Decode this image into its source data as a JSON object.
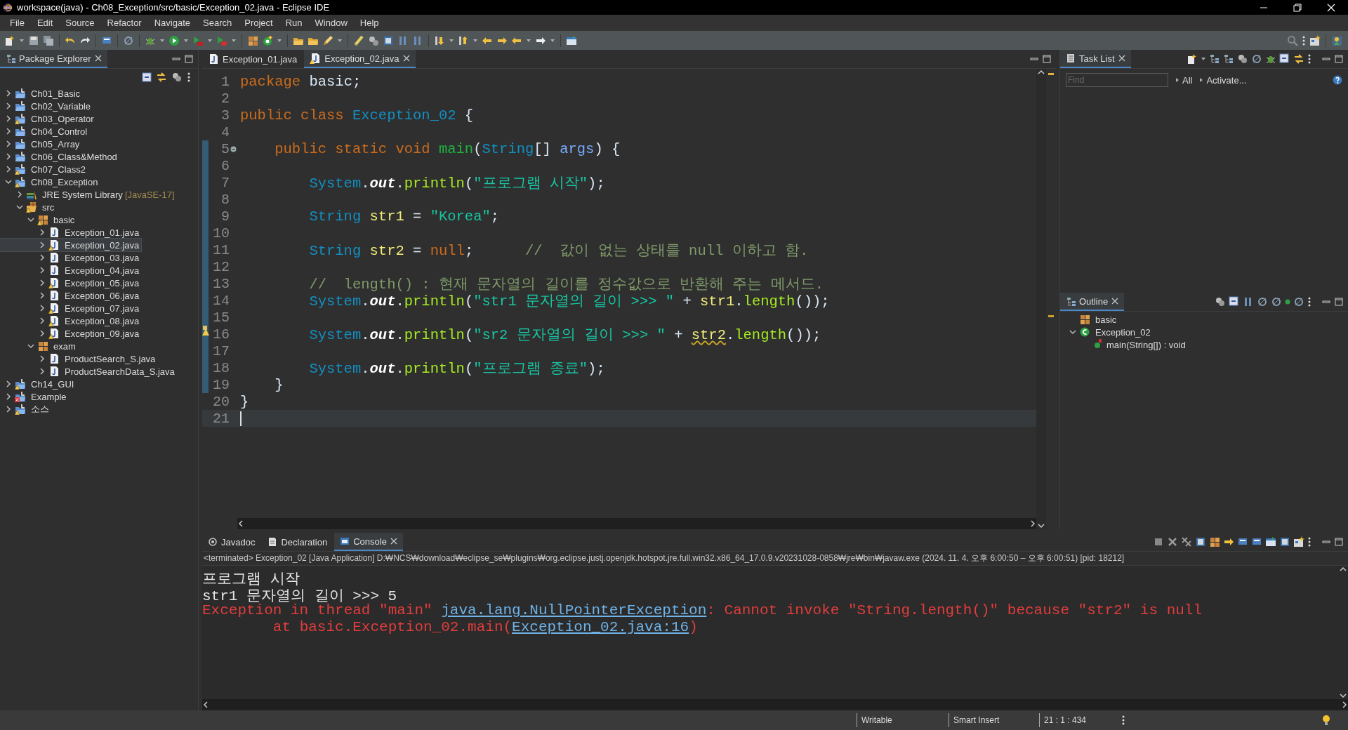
{
  "window": {
    "title": "workspace(java) - Ch08_Exception/src/basic/Exception_02.java - Eclipse IDE"
  },
  "menu": [
    "File",
    "Edit",
    "Source",
    "Refactor",
    "Navigate",
    "Search",
    "Project",
    "Run",
    "Window",
    "Help"
  ],
  "package_explorer": {
    "title": "Package Explorer",
    "tree": [
      {
        "label": "Ch01_Basic",
        "kind": "project",
        "expanded": false,
        "warning": false,
        "error": false,
        "selected": false
      },
      {
        "label": "Ch02_Variable",
        "kind": "project",
        "expanded": false,
        "warning": false,
        "error": false,
        "selected": false
      },
      {
        "label": "Ch03_Operator",
        "kind": "project",
        "expanded": false,
        "warning": true,
        "error": false,
        "selected": false
      },
      {
        "label": "Ch04_Control",
        "kind": "project",
        "expanded": false,
        "warning": false,
        "error": false,
        "selected": false
      },
      {
        "label": "Ch05_Array",
        "kind": "project",
        "expanded": false,
        "warning": false,
        "error": false,
        "selected": false
      },
      {
        "label": "Ch06_Class&Method",
        "kind": "project",
        "expanded": false,
        "warning": false,
        "error": false,
        "selected": false
      },
      {
        "label": "Ch07_Class2",
        "kind": "project",
        "expanded": false,
        "warning": true,
        "error": false,
        "selected": false
      },
      {
        "label": "Ch08_Exception",
        "kind": "project",
        "expanded": true,
        "warning": true,
        "error": false,
        "selected": false,
        "children": [
          {
            "label": "JRE System Library",
            "decoration": "[JavaSE-17]",
            "kind": "library",
            "expanded": false,
            "warning": false,
            "error": false,
            "selected": false
          },
          {
            "label": "src",
            "kind": "source",
            "expanded": true,
            "warning": true,
            "error": false,
            "selected": false,
            "children": [
              {
                "label": "basic",
                "kind": "package",
                "expanded": true,
                "warning": true,
                "error": false,
                "selected": false,
                "children": [
                  {
                    "label": "Exception_01.java",
                    "kind": "file",
                    "expanded": false,
                    "warning": false,
                    "error": false,
                    "selected": false
                  },
                  {
                    "label": "Exception_02.java",
                    "kind": "file",
                    "expanded": false,
                    "warning": true,
                    "error": false,
                    "selected": true
                  },
                  {
                    "label": "Exception_03.java",
                    "kind": "file",
                    "expanded": false,
                    "warning": false,
                    "error": false,
                    "selected": false
                  },
                  {
                    "label": "Exception_04.java",
                    "kind": "file",
                    "expanded": false,
                    "warning": false,
                    "error": false,
                    "selected": false
                  },
                  {
                    "label": "Exception_05.java",
                    "kind": "file",
                    "expanded": false,
                    "warning": true,
                    "error": false,
                    "selected": false
                  },
                  {
                    "label": "Exception_06.java",
                    "kind": "file",
                    "expanded": false,
                    "warning": false,
                    "error": false,
                    "selected": false
                  },
                  {
                    "label": "Exception_07.java",
                    "kind": "file",
                    "expanded": false,
                    "warning": true,
                    "error": false,
                    "selected": false
                  },
                  {
                    "label": "Exception_08.java",
                    "kind": "file",
                    "expanded": false,
                    "warning": true,
                    "error": false,
                    "selected": false
                  },
                  {
                    "label": "Exception_09.java",
                    "kind": "file",
                    "expanded": false,
                    "warning": true,
                    "error": false,
                    "selected": false
                  }
                ]
              },
              {
                "label": "exam",
                "kind": "package",
                "expanded": true,
                "warning": false,
                "error": false,
                "selected": false,
                "children": [
                  {
                    "label": "ProductSearch_S.java",
                    "kind": "file",
                    "expanded": false,
                    "warning": false,
                    "error": false,
                    "selected": false
                  },
                  {
                    "label": "ProductSearchData_S.java",
                    "kind": "file",
                    "expanded": false,
                    "warning": false,
                    "error": false,
                    "selected": false
                  }
                ]
              }
            ]
          }
        ]
      },
      {
        "label": "Ch14_GUI",
        "kind": "project",
        "expanded": false,
        "warning": true,
        "error": false,
        "selected": false
      },
      {
        "label": "Example",
        "kind": "project",
        "expanded": false,
        "warning": false,
        "error": true,
        "selected": false
      },
      {
        "label": "소스",
        "kind": "project",
        "expanded": false,
        "warning": true,
        "error": false,
        "selected": false
      }
    ]
  },
  "editor": {
    "tabs": [
      {
        "label": "Exception_01.java",
        "selected": false,
        "warning": false
      },
      {
        "label": "Exception_02.java",
        "selected": true,
        "warning": true
      }
    ],
    "lines": [
      {
        "number": "1",
        "changed": false,
        "current": false,
        "foldable": false,
        "warning": false,
        "tokens": [
          {
            "kind": "keyword",
            "text": "package"
          },
          {
            "kind": "plain",
            "text": " basic;"
          }
        ]
      },
      {
        "number": "2",
        "changed": false,
        "current": false,
        "foldable": false,
        "warning": false
      },
      {
        "number": "3",
        "changed": false,
        "current": false,
        "foldable": false,
        "warning": false,
        "tokens": [
          {
            "kind": "keyword",
            "text": "public class "
          },
          {
            "kind": "type",
            "text": "Exception_02"
          },
          {
            "kind": "plain",
            "text": " {"
          }
        ]
      },
      {
        "number": "4",
        "changed": false,
        "current": false,
        "foldable": false,
        "warning": false
      },
      {
        "number": "5",
        "changed": true,
        "current": false,
        "foldable": true,
        "warning": false,
        "tokens": [
          {
            "kind": "keyword",
            "text": "    public static void "
          },
          {
            "kind": "decl",
            "text": "main"
          },
          {
            "kind": "plain",
            "text": "("
          },
          {
            "kind": "type",
            "text": "String"
          },
          {
            "kind": "plain",
            "text": "[] "
          },
          {
            "kind": "param",
            "text": "args"
          },
          {
            "kind": "plain",
            "text": ") {"
          }
        ]
      },
      {
        "number": "6",
        "changed": true,
        "current": false,
        "foldable": false,
        "warning": false
      },
      {
        "number": "7",
        "changed": true,
        "current": false,
        "foldable": false,
        "warning": false,
        "tokens": [
          {
            "kind": "type",
            "text": "        System"
          },
          {
            "kind": "plain",
            "text": "."
          },
          {
            "kind": "field",
            "text": "out"
          },
          {
            "kind": "plain",
            "text": "."
          },
          {
            "kind": "method",
            "text": "println"
          },
          {
            "kind": "plain",
            "text": "("
          },
          {
            "kind": "string",
            "text": "\"프로그램 시작\""
          },
          {
            "kind": "plain",
            "text": ");"
          }
        ]
      },
      {
        "number": "8",
        "changed": true,
        "current": false,
        "foldable": false,
        "warning": false
      },
      {
        "number": "9",
        "changed": true,
        "current": false,
        "foldable": false,
        "warning": false,
        "tokens": [
          {
            "kind": "type",
            "text": "        String "
          },
          {
            "kind": "local",
            "text": "str1"
          },
          {
            "kind": "plain",
            "text": " = "
          },
          {
            "kind": "string",
            "text": "\"Korea\""
          },
          {
            "kind": "plain",
            "text": ";"
          }
        ]
      },
      {
        "number": "10",
        "changed": true,
        "current": false,
        "foldable": false,
        "warning": false
      },
      {
        "number": "11",
        "changed": true,
        "current": false,
        "foldable": false,
        "warning": false,
        "tokens": [
          {
            "kind": "type",
            "text": "        String "
          },
          {
            "kind": "local",
            "text": "str2"
          },
          {
            "kind": "plain",
            "text": " = "
          },
          {
            "kind": "keyword",
            "text": "null"
          },
          {
            "kind": "plain",
            "text": ";      "
          },
          {
            "kind": "comment",
            "text": "//  값이 없는 상태를 null 이하고 함."
          }
        ]
      },
      {
        "number": "12",
        "changed": true,
        "current": false,
        "foldable": false,
        "warning": false
      },
      {
        "number": "13",
        "changed": true,
        "current": false,
        "foldable": false,
        "warning": false,
        "tokens": [
          {
            "kind": "comment",
            "text": "        //  length() : 현재 문자열의 길이를 정수값으로 반환해 주는 메서드."
          }
        ]
      },
      {
        "number": "14",
        "changed": true,
        "current": false,
        "foldable": false,
        "warning": false,
        "tokens": [
          {
            "kind": "type",
            "text": "        System"
          },
          {
            "kind": "plain",
            "text": "."
          },
          {
            "kind": "field",
            "text": "out"
          },
          {
            "kind": "plain",
            "text": "."
          },
          {
            "kind": "method",
            "text": "println"
          },
          {
            "kind": "plain",
            "text": "("
          },
          {
            "kind": "string",
            "text": "\"str1 문자열의 길이 >>> \""
          },
          {
            "kind": "plain",
            "text": " + "
          },
          {
            "kind": "local",
            "text": "str1"
          },
          {
            "kind": "plain",
            "text": "."
          },
          {
            "kind": "method",
            "text": "length"
          },
          {
            "kind": "plain",
            "text": "());"
          }
        ]
      },
      {
        "number": "15",
        "changed": true,
        "current": false,
        "foldable": false,
        "warning": false
      },
      {
        "number": "16",
        "changed": true,
        "current": false,
        "foldable": false,
        "warning": true,
        "tokens": [
          {
            "kind": "type",
            "text": "        System"
          },
          {
            "kind": "plain",
            "text": "."
          },
          {
            "kind": "field",
            "text": "out"
          },
          {
            "kind": "plain",
            "text": "."
          },
          {
            "kind": "method",
            "text": "println"
          },
          {
            "kind": "plain",
            "text": "("
          },
          {
            "kind": "string",
            "text": "\"sr2 문자열의 길이 >>> \""
          },
          {
            "kind": "plain",
            "text": " + "
          },
          {
            "kind": "local_warning",
            "text": "str2"
          },
          {
            "kind": "plain",
            "text": "."
          },
          {
            "kind": "method",
            "text": "length"
          },
          {
            "kind": "plain",
            "text": "());"
          }
        ]
      },
      {
        "number": "17",
        "changed": true,
        "current": false,
        "foldable": false,
        "warning": false
      },
      {
        "number": "18",
        "changed": true,
        "current": false,
        "foldable": false,
        "warning": false,
        "tokens": [
          {
            "kind": "type",
            "text": "        System"
          },
          {
            "kind": "plain",
            "text": "."
          },
          {
            "kind": "field",
            "text": "out"
          },
          {
            "kind": "plain",
            "text": "."
          },
          {
            "kind": "method",
            "text": "println"
          },
          {
            "kind": "plain",
            "text": "("
          },
          {
            "kind": "string",
            "text": "\"프로그램 종료\""
          },
          {
            "kind": "plain",
            "text": ");"
          }
        ]
      },
      {
        "number": "19",
        "changed": true,
        "current": false,
        "foldable": false,
        "warning": false,
        "tokens": [
          {
            "kind": "plain",
            "text": "    }"
          }
        ]
      },
      {
        "number": "20",
        "changed": false,
        "current": false,
        "foldable": false,
        "warning": false,
        "tokens": [
          {
            "kind": "plain",
            "text": "}"
          }
        ]
      },
      {
        "number": "21",
        "changed": false,
        "current": true,
        "foldable": false,
        "warning": false
      }
    ]
  },
  "console": {
    "tabs": [
      {
        "label": "Javadoc",
        "selected": false
      },
      {
        "label": "Declaration",
        "selected": false
      },
      {
        "label": "Console",
        "selected": true
      }
    ],
    "header": "<terminated> Exception_02 [Java Application] D:₩NCS₩download₩eclipse_se₩plugins₩org.eclipse.justj.openjdk.hotspot.jre.full.win32.x86_64_17.0.9.v20231028-0858₩jre₩bin₩javaw.exe  (2024. 11. 4. 오후 6:00:50 – 오후 6:00:51) [pid: 18212]",
    "lines": [
      {
        "kind": "stdout",
        "segments": [
          {
            "text": "프로그램 시작",
            "link": false
          }
        ]
      },
      {
        "kind": "stdout",
        "segments": [
          {
            "text": "str1 문자열의 길이 >>> 5",
            "link": false
          }
        ]
      },
      {
        "kind": "stderr",
        "segments": [
          {
            "text": "Exception in thread \"main\" ",
            "link": false
          },
          {
            "text": "java.lang.NullPointerException",
            "link": true
          },
          {
            "text": ": Cannot invoke \"String.length()\" because \"str2\" is null",
            "link": false
          }
        ]
      },
      {
        "kind": "stderr",
        "segments": [
          {
            "text": "\tat basic.Exception_02.main(",
            "link": false
          },
          {
            "text": "Exception_02.java:16",
            "link": true
          },
          {
            "text": ")",
            "link": false
          }
        ]
      }
    ]
  },
  "task_list": {
    "title": "Task List",
    "find": {
      "placeholder": "Find"
    },
    "links": [
      "All",
      "Activate..."
    ]
  },
  "outline": {
    "title": "Outline",
    "tree": [
      {
        "label": "basic",
        "kind": "package",
        "selected": false
      },
      {
        "label": "Exception_02",
        "kind": "class",
        "expanded": true,
        "selected": false,
        "children": [
          {
            "label": "main(String[]) : void",
            "kind": "method",
            "selected": false
          }
        ]
      }
    ]
  },
  "status_bar": {
    "mode": "Writable",
    "insert": "Smart Insert",
    "position": "21 : 1 : 434"
  }
}
